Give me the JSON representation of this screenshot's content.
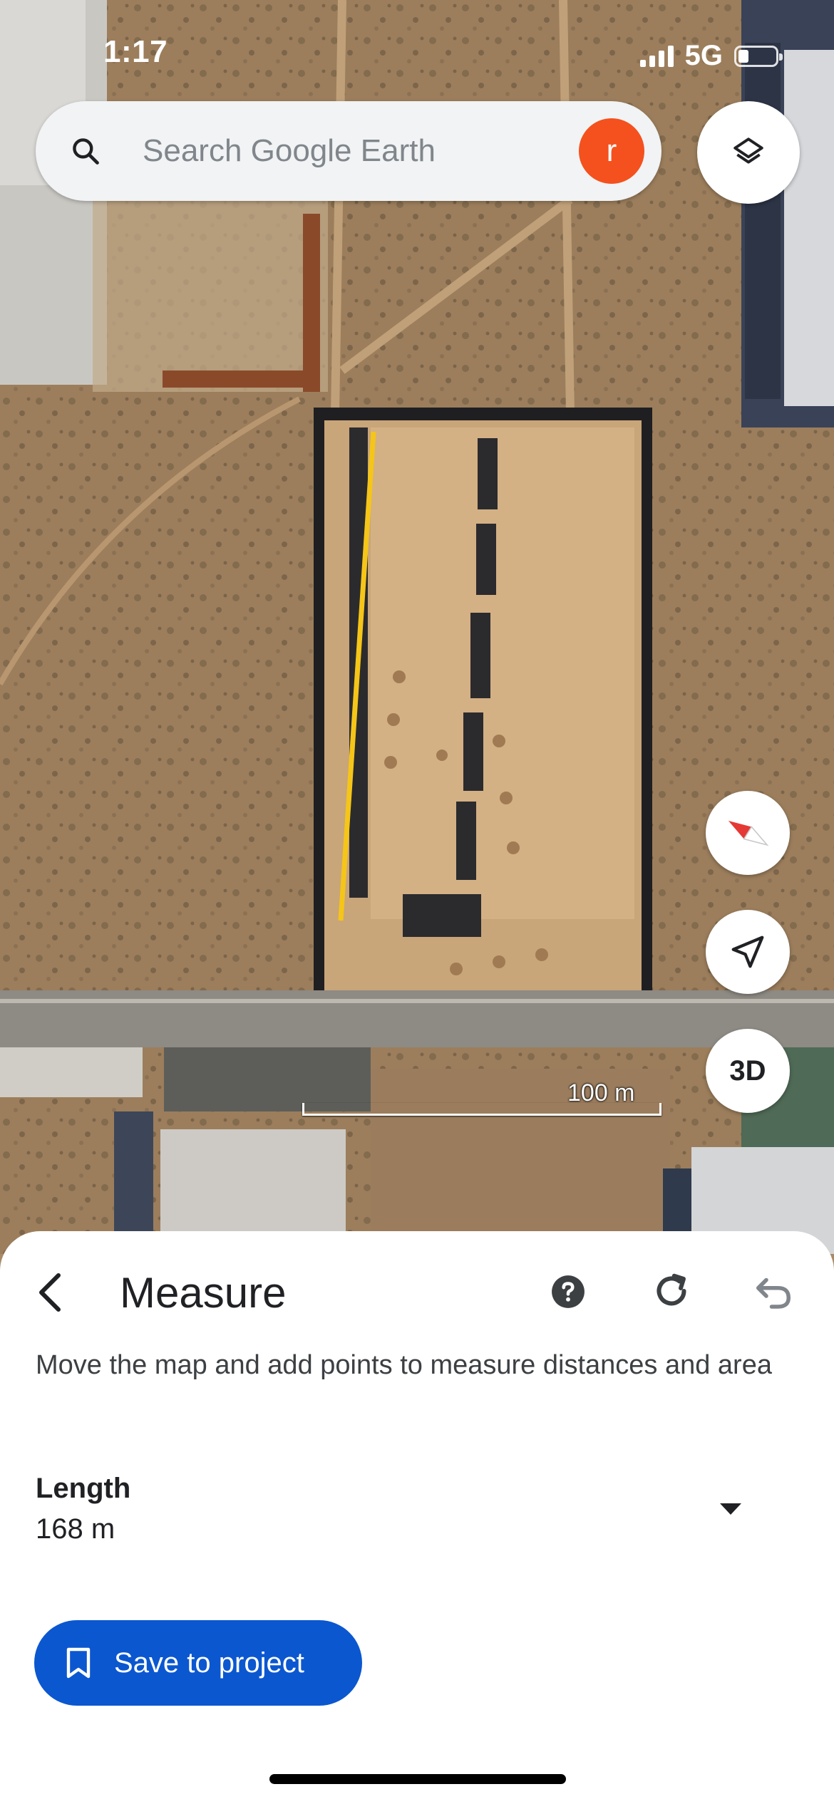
{
  "status_bar": {
    "time": "1:17",
    "network": "5G"
  },
  "search": {
    "placeholder": "Search Google Earth",
    "avatar_initial": "r"
  },
  "map_controls": {
    "three_d_label": "3D",
    "scale_label": "100 m"
  },
  "measure_sheet": {
    "title": "Measure",
    "instructions": "Move the map and add points to measure distances and area",
    "length_label": "Length",
    "length_value": "168 m",
    "save_button_label": "Save to project"
  },
  "colors": {
    "avatar": "#f4511e",
    "measure_line": "#f5c518",
    "primary_button": "#0b57d0",
    "compass_north": "#e53935"
  },
  "icons": [
    "search-icon",
    "layers-icon",
    "compass-icon",
    "location-arrow-icon",
    "back-arrow-icon",
    "help-icon",
    "reset-icon",
    "undo-icon",
    "dropdown-arrow-icon",
    "bookmark-icon"
  ]
}
